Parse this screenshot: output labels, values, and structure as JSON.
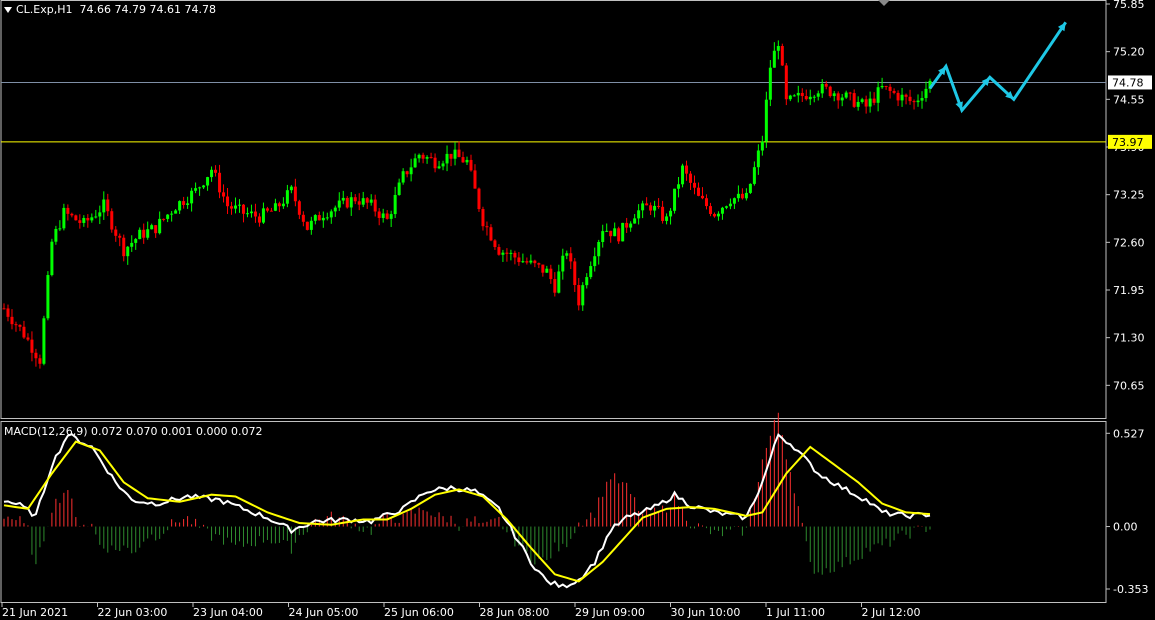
{
  "header": {
    "symbol": "CL.Exp,H1",
    "ohlc": "74.66 74.79 74.61 74.78"
  },
  "macd_header": "MACD(12,26,9) 0.072 0.070 0.001 0.000 0.072",
  "colors": {
    "background": "#000000",
    "bull": "#00ff00",
    "bear": "#ff0000",
    "grid_frame": "#c0c0c0",
    "bid_line": "#7f8fa6",
    "support_line": "#ffff00",
    "forecast": "#1ec8e6",
    "macd_main": "#ffffff",
    "macd_signal": "#ffff00",
    "osma_pos": "#ff3030",
    "osma_neg": "#2e8b2e"
  },
  "chart_data": [
    {
      "type": "candlestick",
      "title": "CL.Exp,H1",
      "ylim": [
        70.45,
        75.85
      ],
      "y_ticks": [
        "75.85",
        "75.20",
        "74.55",
        "73.90",
        "73.25",
        "72.60",
        "71.95",
        "71.30",
        "70.65"
      ],
      "price_labels": [
        {
          "value": 74.78,
          "text": "74.78",
          "kind": "bid"
        },
        {
          "value": 73.97,
          "text": "73.97",
          "kind": "support"
        }
      ],
      "x_tick_labels": [
        "21 Jun 2021",
        "22 Jun 03:00",
        "23 Jun 04:00",
        "24 Jun 05:00",
        "25 Jun 06:00",
        "28 Jun 08:00",
        "29 Jun 09:00",
        "30 Jun 10:00",
        "1 Jul 11:00",
        "2 Jul 12:00"
      ],
      "anchors": [
        [
          0,
          71.7
        ],
        [
          5,
          71.35
        ],
        [
          9,
          71.0
        ],
        [
          12,
          72.6
        ],
        [
          15,
          73.0
        ],
        [
          20,
          72.85
        ],
        [
          25,
          73.1
        ],
        [
          30,
          72.5
        ],
        [
          34,
          72.7
        ],
        [
          38,
          72.8
        ],
        [
          43,
          73.1
        ],
        [
          48,
          73.3
        ],
        [
          52,
          73.6
        ],
        [
          56,
          73.1
        ],
        [
          60,
          73.0
        ],
        [
          64,
          72.95
        ],
        [
          68,
          73.05
        ],
        [
          72,
          73.3
        ],
        [
          76,
          72.8
        ],
        [
          80,
          73.0
        ],
        [
          84,
          73.1
        ],
        [
          88,
          73.2
        ],
        [
          92,
          73.1
        ],
        [
          96,
          72.9
        ],
        [
          100,
          73.5
        ],
        [
          104,
          73.8
        ],
        [
          108,
          73.7
        ],
        [
          112,
          73.8
        ],
        [
          116,
          73.7
        ],
        [
          120,
          72.9
        ],
        [
          124,
          72.5
        ],
        [
          128,
          72.4
        ],
        [
          132,
          72.3
        ],
        [
          136,
          72.2
        ],
        [
          138,
          72.0
        ],
        [
          141,
          72.5
        ],
        [
          144,
          71.8
        ],
        [
          146,
          72.2
        ],
        [
          150,
          72.8
        ],
        [
          154,
          72.7
        ],
        [
          158,
          73.0
        ],
        [
          162,
          73.1
        ],
        [
          166,
          72.9
        ],
        [
          170,
          73.6
        ],
        [
          174,
          73.2
        ],
        [
          178,
          73.0
        ],
        [
          182,
          73.2
        ],
        [
          186,
          73.2
        ],
        [
          188,
          73.6
        ],
        [
          190,
          74.0
        ],
        [
          192,
          75.0
        ],
        [
          194,
          75.35
        ],
        [
          196,
          74.5
        ],
        [
          200,
          74.6
        ],
        [
          204,
          74.7
        ],
        [
          208,
          74.65
        ],
        [
          212,
          74.55
        ],
        [
          216,
          74.45
        ],
        [
          220,
          74.7
        ],
        [
          224,
          74.6
        ],
        [
          228,
          74.5
        ],
        [
          232,
          74.78
        ]
      ],
      "forecast_path": [
        [
          232,
          74.7
        ],
        [
          236,
          75.0
        ],
        [
          240,
          74.4
        ],
        [
          247,
          74.85
        ],
        [
          253,
          74.55
        ],
        [
          266,
          75.6
        ]
      ],
      "candle_count": 233
    },
    {
      "type": "macd",
      "title": "MACD(12,26,9)",
      "values": {
        "main": 0.072,
        "signal": 0.07,
        "osma": 0.001,
        "extra1": 0.0,
        "extra2": 0.072
      },
      "ylim": [
        -0.37,
        0.54
      ],
      "y_ticks": [
        "0.527",
        "0.00",
        "-0.353"
      ],
      "main_anchors": [
        [
          0,
          0.15
        ],
        [
          4,
          0.12
        ],
        [
          8,
          0.06
        ],
        [
          12,
          0.35
        ],
        [
          16,
          0.52
        ],
        [
          22,
          0.45
        ],
        [
          28,
          0.25
        ],
        [
          32,
          0.15
        ],
        [
          38,
          0.13
        ],
        [
          46,
          0.17
        ],
        [
          54,
          0.15
        ],
        [
          60,
          0.1
        ],
        [
          66,
          0.05
        ],
        [
          72,
          -0.02
        ],
        [
          78,
          0.03
        ],
        [
          86,
          0.04
        ],
        [
          92,
          0.03
        ],
        [
          100,
          0.1
        ],
        [
          106,
          0.2
        ],
        [
          112,
          0.22
        ],
        [
          118,
          0.2
        ],
        [
          124,
          0.1
        ],
        [
          128,
          -0.05
        ],
        [
          132,
          -0.2
        ],
        [
          136,
          -0.31
        ],
        [
          140,
          -0.34
        ],
        [
          144,
          -0.3
        ],
        [
          148,
          -0.2
        ],
        [
          152,
          -0.02
        ],
        [
          156,
          0.05
        ],
        [
          160,
          0.08
        ],
        [
          164,
          0.12
        ],
        [
          168,
          0.18
        ],
        [
          172,
          0.12
        ],
        [
          178,
          0.08
        ],
        [
          186,
          0.05
        ],
        [
          190,
          0.25
        ],
        [
          194,
          0.52
        ],
        [
          198,
          0.45
        ],
        [
          204,
          0.3
        ],
        [
          210,
          0.22
        ],
        [
          216,
          0.15
        ],
        [
          220,
          0.08
        ],
        [
          226,
          0.06
        ],
        [
          232,
          0.07
        ]
      ],
      "signal_anchors": [
        [
          0,
          0.12
        ],
        [
          6,
          0.1
        ],
        [
          12,
          0.3
        ],
        [
          18,
          0.48
        ],
        [
          24,
          0.43
        ],
        [
          30,
          0.25
        ],
        [
          36,
          0.16
        ],
        [
          44,
          0.14
        ],
        [
          52,
          0.18
        ],
        [
          58,
          0.17
        ],
        [
          66,
          0.08
        ],
        [
          74,
          0.02
        ],
        [
          82,
          0.01
        ],
        [
          90,
          0.04
        ],
        [
          96,
          0.04
        ],
        [
          102,
          0.1
        ],
        [
          108,
          0.18
        ],
        [
          114,
          0.21
        ],
        [
          120,
          0.17
        ],
        [
          126,
          0.04
        ],
        [
          132,
          -0.12
        ],
        [
          138,
          -0.27
        ],
        [
          144,
          -0.31
        ],
        [
          150,
          -0.2
        ],
        [
          156,
          -0.05
        ],
        [
          160,
          0.05
        ],
        [
          166,
          0.1
        ],
        [
          172,
          0.11
        ],
        [
          178,
          0.1
        ],
        [
          186,
          0.06
        ],
        [
          190,
          0.08
        ],
        [
          196,
          0.3
        ],
        [
          202,
          0.45
        ],
        [
          208,
          0.35
        ],
        [
          214,
          0.25
        ],
        [
          220,
          0.13
        ],
        [
          226,
          0.08
        ],
        [
          232,
          0.07
        ]
      ]
    }
  ]
}
